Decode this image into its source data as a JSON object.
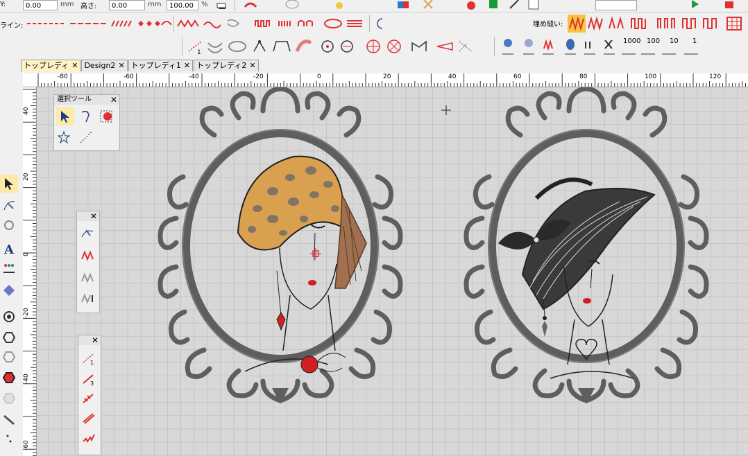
{
  "props": {
    "y_label": "Y:",
    "y_value": "0.00",
    "y_unit": "mm",
    "height_label": "高さ:",
    "height_value": "0.00",
    "height_unit": "mm",
    "percent_value": "100.00",
    "percent_unit": "%"
  },
  "line_toolbar": {
    "label": "ライン:"
  },
  "fill_toolbar": {
    "label": "埋め縫い:",
    "counts": [
      "1000",
      "100",
      "10",
      "1"
    ]
  },
  "tabs": [
    {
      "label": "トップレディ"
    },
    {
      "label": "Design2"
    },
    {
      "label": "トップレディ1"
    },
    {
      "label": "トップレディ2"
    }
  ],
  "ruler_h": [
    "-80",
    "-60",
    "-40",
    "-20",
    "0",
    "20",
    "40",
    "60",
    "80",
    "100",
    "120"
  ],
  "ruler_v": [
    "40",
    "20",
    "0",
    "-20",
    "-40",
    "-60"
  ],
  "select_panel": {
    "title": "選択ツール"
  },
  "colors": {
    "accent": "#e03030",
    "frame": "#5e5e5e",
    "hat": "#d9a050",
    "lips": "#d02020"
  }
}
